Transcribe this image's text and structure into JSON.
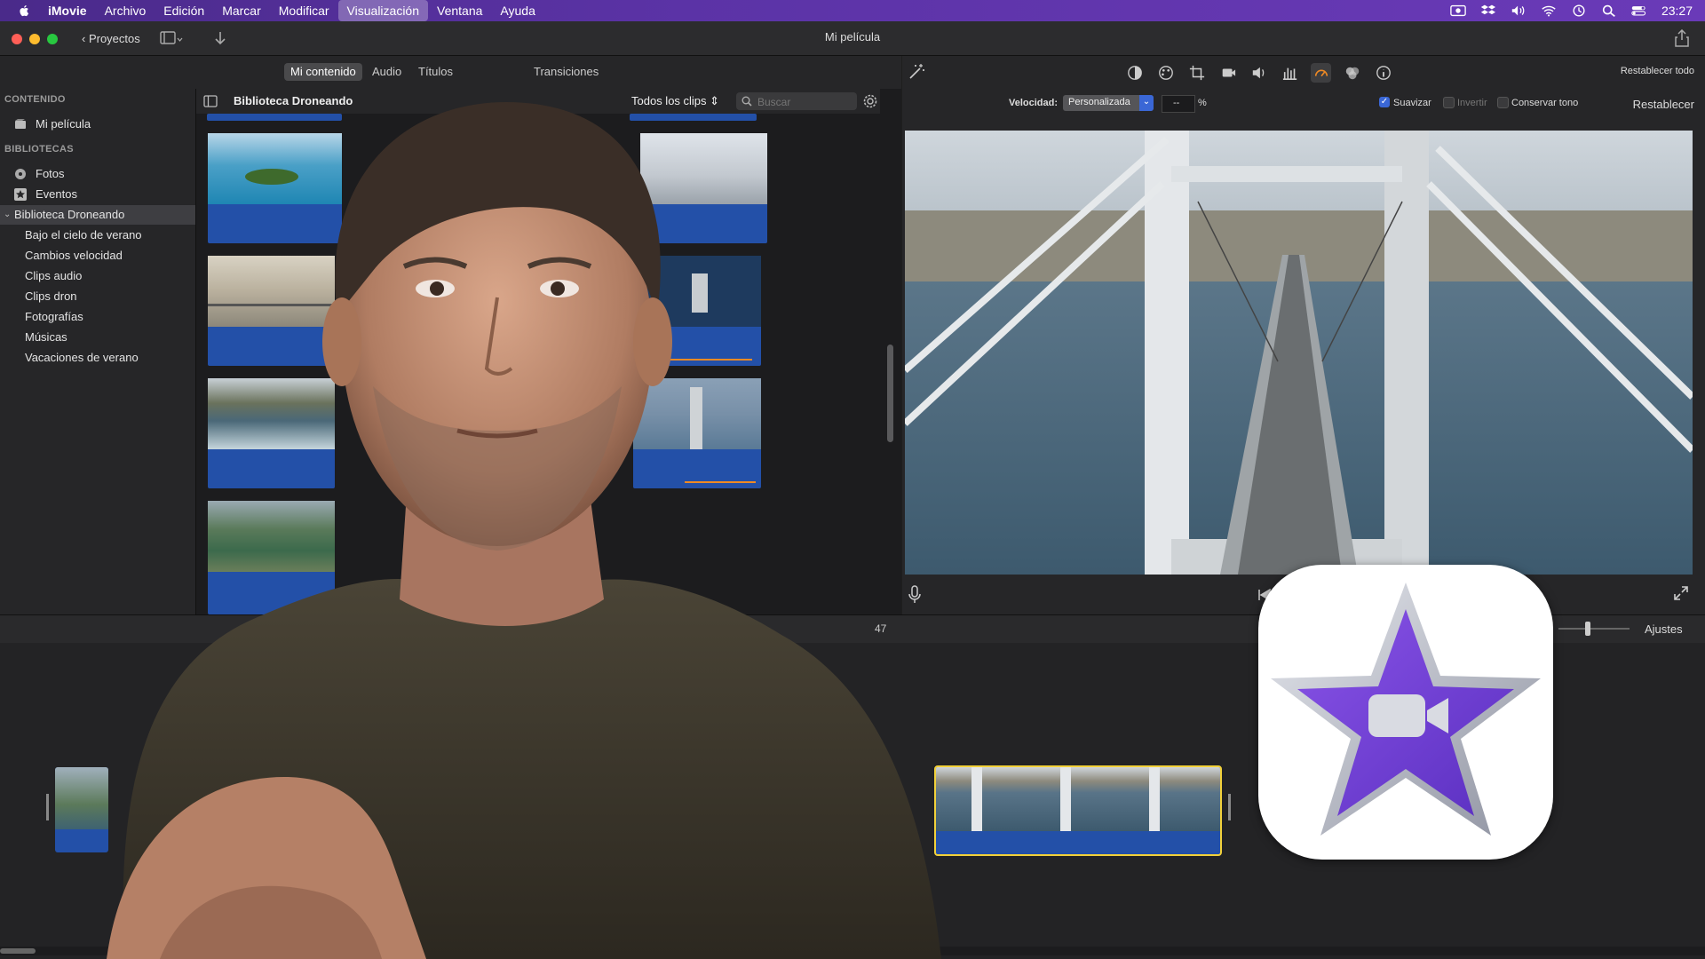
{
  "menubar": {
    "items": [
      "iMovie",
      "Archivo",
      "Edición",
      "Marcar",
      "Modificar",
      "Visualización",
      "Ventana",
      "Ayuda"
    ],
    "active": "Visualización",
    "clock": "23:27"
  },
  "window": {
    "title": "Mi película",
    "projects_label": "Proyectos"
  },
  "browser_tabs": [
    "Mi contenido",
    "Audio",
    "Títulos",
    "Transiciones"
  ],
  "sidebar": {
    "content_header": "CONTENIDO",
    "movie_item": "Mi película",
    "libraries_header": "BIBLIOTECAS",
    "photos": "Fotos",
    "events": "Eventos",
    "library": "Biblioteca Droneando",
    "events_list": [
      "Bajo el cielo de verano",
      "Cambios velocidad",
      "Clips audio",
      "Clips dron",
      "Fotografías",
      "Músicas",
      "Vacaciones de verano"
    ]
  },
  "browser": {
    "title": "Biblioteca Droneando",
    "filter": "Todos los clips",
    "search_placeholder": "Buscar"
  },
  "viewer": {
    "reset_all": "Restablecer todo",
    "speed_label": "Velocidad:",
    "speed_value": "Personalizada",
    "speed_percent_value": "--",
    "percent_sign": "%",
    "smooth_label": "Suavizar",
    "invert_label": "Invertir",
    "keep_pitch_label": "Conservar tono",
    "reset": "Restablecer"
  },
  "timeline": {
    "timecode_fragment": "47",
    "settings_label": "Ajustes"
  },
  "colors": {
    "accent": "#5b33a6",
    "clip_blue": "#2350a8",
    "selected_clip_border": "#f2d13a",
    "speed_orange": "#f08a24"
  }
}
